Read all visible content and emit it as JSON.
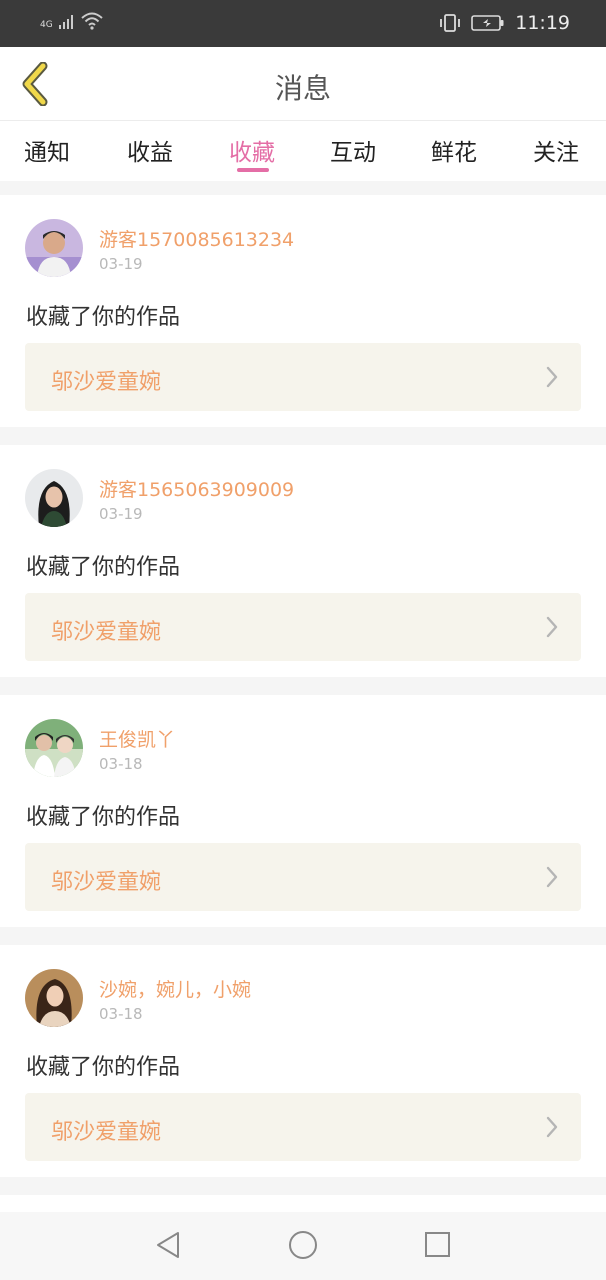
{
  "status_bar": {
    "network": "4G",
    "time": "11:19"
  },
  "header": {
    "title": "消息"
  },
  "tabs": [
    {
      "label": "通知"
    },
    {
      "label": "收益"
    },
    {
      "label": "收藏",
      "active": true
    },
    {
      "label": "互动"
    },
    {
      "label": "鲜花"
    },
    {
      "label": "关注"
    }
  ],
  "messages": [
    {
      "username": "游客1570085613234",
      "date": "03-19",
      "action": "收藏了你的作品",
      "work": "邬沙爱童婉"
    },
    {
      "username": "游客1565063909009",
      "date": "03-19",
      "action": "收藏了你的作品",
      "work": "邬沙爱童婉"
    },
    {
      "username": "王俊凯丫",
      "date": "03-18",
      "action": "收藏了你的作品",
      "work": "邬沙爱童婉"
    },
    {
      "username": "沙婉，婉儿，小婉",
      "date": "03-18",
      "action": "收藏了你的作品",
      "work": "邬沙爱童婉"
    }
  ],
  "colors": {
    "accent_pink": "#e46ea6",
    "name_orange": "#f0a06a",
    "back_arrow_yellow": "#f0d84a"
  },
  "icons": {
    "back": "chevron-left-icon",
    "item_arrow": "chevron-right-icon",
    "nav": [
      "back-triangle-icon",
      "home-circle-icon",
      "recents-square-icon"
    ]
  }
}
